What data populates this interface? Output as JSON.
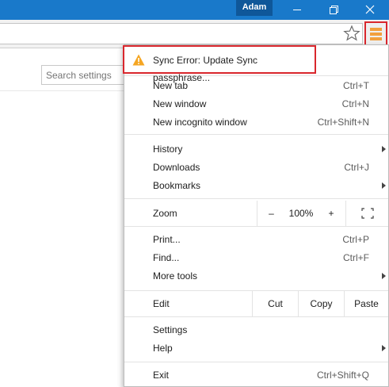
{
  "titlebar": {
    "user": "Adam",
    "color": "#1979ca"
  },
  "search": {
    "placeholder": "Search settings"
  },
  "menu": {
    "sync_error": "Sync Error: Update Sync passphrase...",
    "group1": [
      {
        "label": "New tab",
        "shortcut": "Ctrl+T"
      },
      {
        "label": "New window",
        "shortcut": "Ctrl+N"
      },
      {
        "label": "New incognito window",
        "shortcut": "Ctrl+Shift+N"
      }
    ],
    "group2": [
      {
        "label": "History",
        "shortcut": ""
      },
      {
        "label": "Downloads",
        "shortcut": "Ctrl+J"
      },
      {
        "label": "Bookmarks",
        "shortcut": ""
      }
    ],
    "zoom": {
      "label": "Zoom",
      "minus": "–",
      "value": "100%",
      "plus": "+"
    },
    "group3": [
      {
        "label": "Print...",
        "shortcut": "Ctrl+P"
      },
      {
        "label": "Find...",
        "shortcut": "Ctrl+F"
      },
      {
        "label": "More tools",
        "shortcut": ""
      }
    ],
    "edit": {
      "label": "Edit",
      "cut": "Cut",
      "copy": "Copy",
      "paste": "Paste"
    },
    "group4": [
      {
        "label": "Settings",
        "shortcut": ""
      },
      {
        "label": "Help",
        "shortcut": ""
      }
    ],
    "exit": {
      "label": "Exit",
      "shortcut": "Ctrl+Shift+Q"
    }
  },
  "icons": {
    "warning": "warning-icon",
    "menu": "hamburger-menu-icon",
    "star": "star-icon",
    "fullscreen": "fullscreen-icon"
  },
  "colors": {
    "highlight": "#d9272d",
    "warning": "#f5a623",
    "menu_button": "#f2a03d"
  }
}
